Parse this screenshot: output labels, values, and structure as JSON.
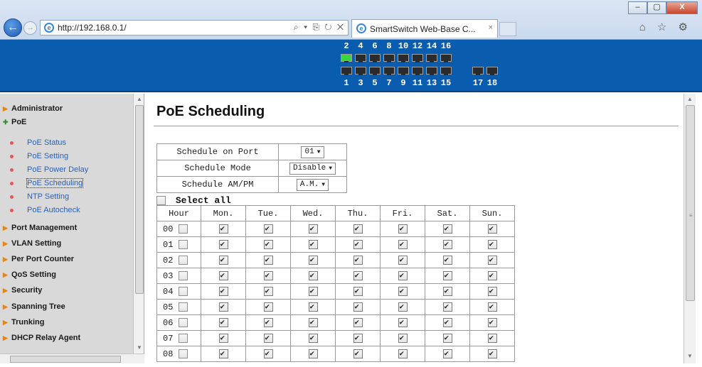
{
  "browser": {
    "url": "http://192.168.0.1/",
    "tab_title": "SmartSwitch Web-Base C...",
    "tab_close": "×",
    "address_tools": "⌕ ▾ ⎘ ↻ ✕",
    "win_minimize": "–",
    "win_maximize": "▢",
    "win_close": "X",
    "chrome_icons": "⌂ ☆ ⚙"
  },
  "switch_panel": {
    "top_ports": [
      "2",
      "4",
      "6",
      "8",
      "10",
      "12",
      "14",
      "16"
    ],
    "bottom_ports": [
      "1",
      "3",
      "5",
      "7",
      "9",
      "11",
      "13",
      "15"
    ],
    "uplink_ports": [
      "17",
      "18"
    ],
    "active_port": "2"
  },
  "sidebar": {
    "categories": [
      {
        "label": "Administrator"
      },
      {
        "label": "PoE"
      },
      {
        "label": "Port Management"
      },
      {
        "label": "VLAN Setting"
      },
      {
        "label": "Per Port Counter"
      },
      {
        "label": "QoS Setting"
      },
      {
        "label": "Security"
      },
      {
        "label": "Spanning Tree"
      },
      {
        "label": "Trunking"
      },
      {
        "label": "DHCP Relay Agent"
      }
    ],
    "poe_items": [
      {
        "label": "PoE Status"
      },
      {
        "label": "PoE Setting"
      },
      {
        "label": "PoE Power Delay"
      },
      {
        "label": "PoE Scheduling"
      },
      {
        "label": "NTP Setting"
      },
      {
        "label": "PoE Autocheck"
      }
    ],
    "selected": "PoE Scheduling"
  },
  "main": {
    "title": "PoE Scheduling",
    "config": {
      "port_label": "Schedule on Port",
      "port_value": "01",
      "mode_label": "Schedule Mode",
      "mode_value": "Disable",
      "ampm_label": "Schedule AM/PM",
      "ampm_value": "A.M."
    },
    "select_all_label": "Select all",
    "select_all_checked": false,
    "table": {
      "headers": [
        "Hour",
        "Mon.",
        "Tue.",
        "Wed.",
        "Thu.",
        "Fri.",
        "Sat.",
        "Sun."
      ],
      "rows": [
        {
          "hour": "00",
          "hour_checked": false,
          "days": [
            true,
            true,
            true,
            true,
            true,
            true,
            true
          ]
        },
        {
          "hour": "01",
          "hour_checked": false,
          "days": [
            true,
            true,
            true,
            true,
            true,
            true,
            true
          ]
        },
        {
          "hour": "02",
          "hour_checked": false,
          "days": [
            true,
            true,
            true,
            true,
            true,
            true,
            true
          ]
        },
        {
          "hour": "03",
          "hour_checked": false,
          "days": [
            true,
            true,
            true,
            true,
            true,
            true,
            true
          ]
        },
        {
          "hour": "04",
          "hour_checked": false,
          "days": [
            true,
            true,
            true,
            true,
            true,
            true,
            true
          ]
        },
        {
          "hour": "05",
          "hour_checked": false,
          "days": [
            true,
            true,
            true,
            true,
            true,
            true,
            true
          ]
        },
        {
          "hour": "06",
          "hour_checked": false,
          "days": [
            true,
            true,
            true,
            true,
            true,
            true,
            true
          ]
        },
        {
          "hour": "07",
          "hour_checked": false,
          "days": [
            true,
            true,
            true,
            true,
            true,
            true,
            true
          ]
        },
        {
          "hour": "08",
          "hour_checked": false,
          "days": [
            true,
            true,
            true,
            true,
            true,
            true,
            true
          ]
        }
      ]
    }
  }
}
